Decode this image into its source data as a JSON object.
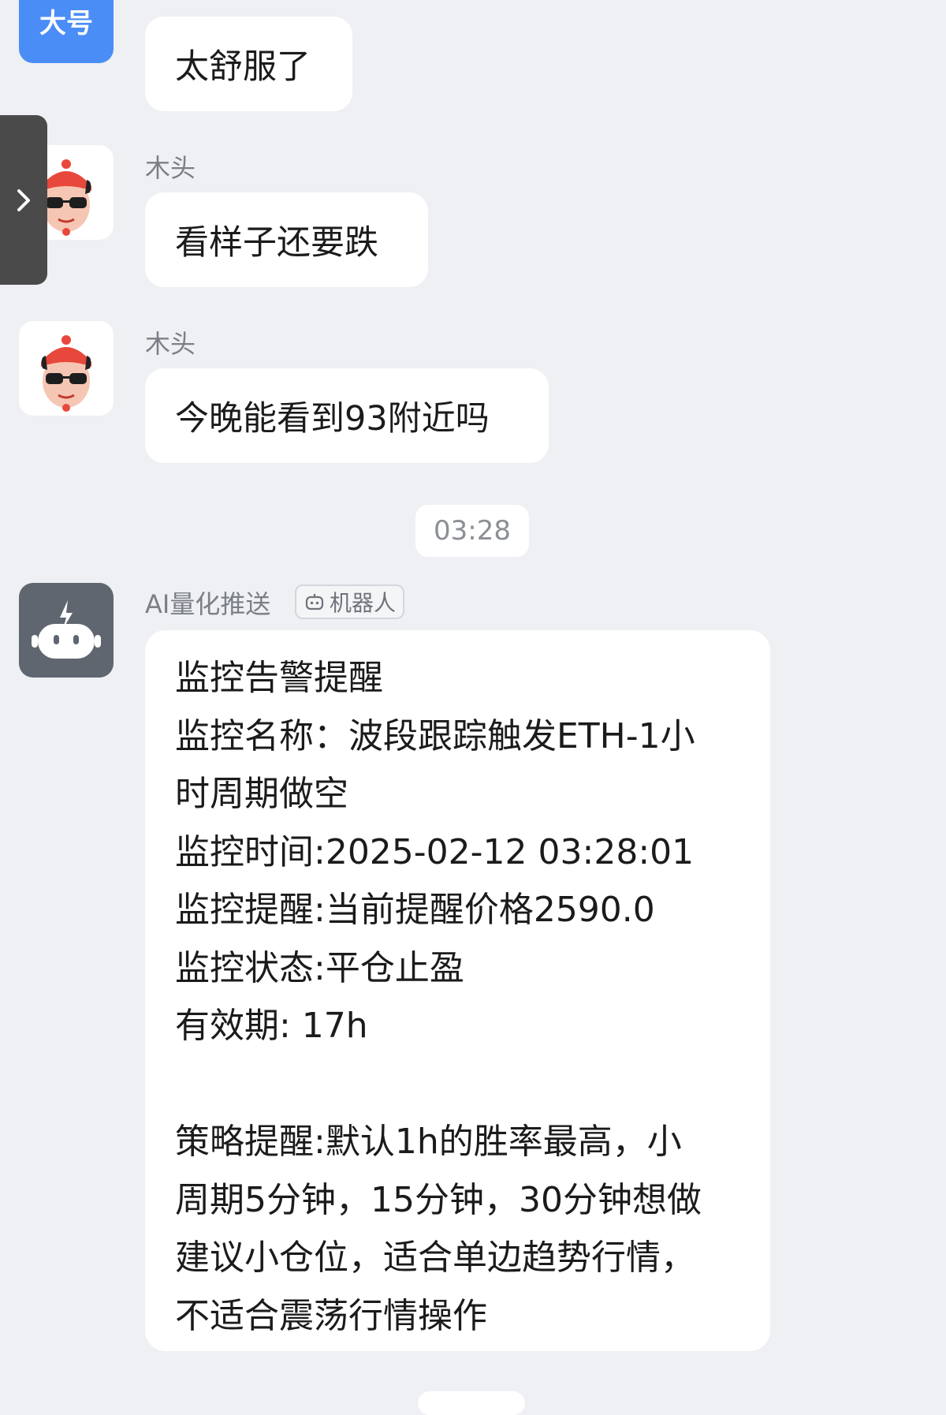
{
  "messages": [
    {
      "sender": "",
      "avatar_text": "大号",
      "text": "太舒服了"
    },
    {
      "sender": "木头",
      "text": "看样子还要跌"
    },
    {
      "sender": "木头",
      "text": "今晚能看到93附近吗"
    }
  ],
  "timestamp": "03:28",
  "bot": {
    "name": "AI量化推送",
    "tag": "机器人",
    "lines": [
      "监控告警提醒",
      "监控名称：波段跟踪触发ETH-1小",
      "时周期做空",
      "监控时间:2025-02-12 03:28:01",
      "监控提醒:当前提醒价格2590.0",
      "监控状态:平仓止盈",
      "有效期: 17h",
      "",
      "策略提醒:默认1h的胜率最高，小",
      "周期5分钟，15分钟，30分钟想做",
      "建议小仓位，适合单边趋势行情，",
      "不适合震荡行情操作"
    ]
  },
  "icons": {
    "side_tab": "chevron-right-icon",
    "bot_tag": "robot-icon"
  },
  "colors": {
    "background": "#eef0f3",
    "bubble": "#ffffff",
    "blue_avatar": "#4a8df6",
    "robot_avatar": "#5f6670",
    "side_tab": "#4a4a4a"
  }
}
